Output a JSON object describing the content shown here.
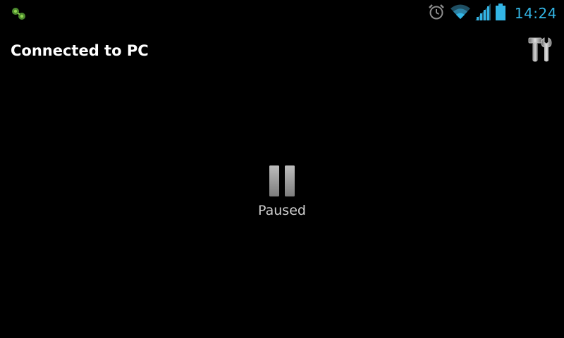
{
  "status_bar": {
    "notification_icon": "remote-link-icon",
    "icons": [
      "alarm-clock-icon",
      "wifi-icon",
      "cell-signal-icon",
      "battery-icon"
    ],
    "time": "14:24",
    "accent_color": "#33b5e5"
  },
  "action_bar": {
    "title": "Connected to PC",
    "settings_icon": "tools-icon"
  },
  "main": {
    "state_icon": "pause-icon",
    "status_text": "Paused"
  }
}
